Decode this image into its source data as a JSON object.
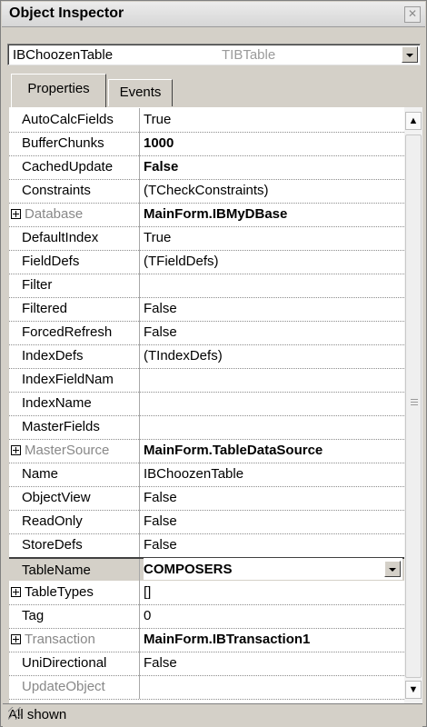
{
  "window": {
    "title": "Object Inspector"
  },
  "selector": {
    "object_name": "IBChoozenTable",
    "object_type": "TIBTable"
  },
  "tabs": [
    {
      "label": "Properties"
    },
    {
      "label": "Events"
    }
  ],
  "properties": [
    {
      "name": "AutoCalcFields",
      "value": "True"
    },
    {
      "name": "BufferChunks",
      "value": "1000"
    },
    {
      "name": "CachedUpdate",
      "value": "False"
    },
    {
      "name": "Constraints",
      "value": "(TCheckConstraints)"
    },
    {
      "name": "Database",
      "value": "MainForm.IBMyDBase"
    },
    {
      "name": "DefaultIndex",
      "value": "True"
    },
    {
      "name": "FieldDefs",
      "value": "(TFieldDefs)"
    },
    {
      "name": "Filter",
      "value": ""
    },
    {
      "name": "Filtered",
      "value": "False"
    },
    {
      "name": "ForcedRefresh",
      "value": "False"
    },
    {
      "name": "IndexDefs",
      "value": "(TIndexDefs)"
    },
    {
      "name": "IndexFieldNam",
      "value": ""
    },
    {
      "name": "IndexName",
      "value": ""
    },
    {
      "name": "MasterFields",
      "value": ""
    },
    {
      "name": "MasterSource",
      "value": "MainForm.TableDataSource"
    },
    {
      "name": "Name",
      "value": "IBChoozenTable"
    },
    {
      "name": "ObjectView",
      "value": "False"
    },
    {
      "name": "ReadOnly",
      "value": "False"
    },
    {
      "name": "StoreDefs",
      "value": "False"
    },
    {
      "name": "TableName",
      "value": "COMPOSERS"
    },
    {
      "name": "TableTypes",
      "value": "[]"
    },
    {
      "name": "Tag",
      "value": "0"
    },
    {
      "name": "Transaction",
      "value": "MainForm.IBTransaction1"
    },
    {
      "name": "UniDirectional",
      "value": "False"
    },
    {
      "name": "UpdateObject",
      "value": ""
    }
  ],
  "status": {
    "text": "All shown"
  }
}
